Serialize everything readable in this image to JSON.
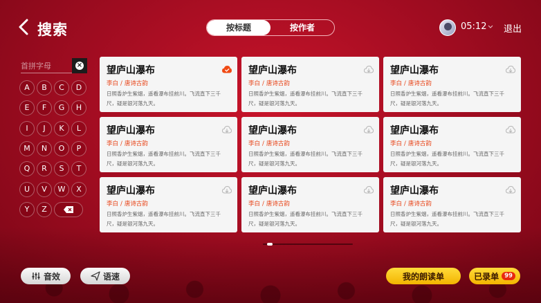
{
  "header": {
    "title": "搜索",
    "tabs": [
      {
        "label": "按标题",
        "active": true
      },
      {
        "label": "按作者",
        "active": false
      }
    ],
    "time": "05:12",
    "exit_label": "退出"
  },
  "search": {
    "placeholder": "首拼字母",
    "value": ""
  },
  "keyboard": {
    "keys": [
      "A",
      "B",
      "C",
      "D",
      "E",
      "F",
      "G",
      "H",
      "I",
      "J",
      "K",
      "L",
      "M",
      "N",
      "O",
      "P",
      "Q",
      "R",
      "S",
      "T",
      "U",
      "V",
      "W",
      "X",
      "Y",
      "Z"
    ],
    "delete_icon": "backspace-icon"
  },
  "cards": [
    {
      "title": "望庐山瀑布",
      "author": "李白",
      "category": "唐诗古韵",
      "text": "日照香炉生紫烟，遥看瀑布挂前川。飞流直下三千尺，疑是银河落九天。",
      "cloud_active": true
    },
    {
      "title": "望庐山瀑布",
      "author": "李白",
      "category": "唐诗古韵",
      "text": "日照香炉生紫烟，遥看瀑布挂前川。飞流直下三千尺，疑是银河落九天。",
      "cloud_active": false
    },
    {
      "title": "望庐山瀑布",
      "author": "李白",
      "category": "唐诗古韵",
      "text": "日照香炉生紫烟，遥看瀑布挂前川。飞流直下三千尺，疑是银河落九天。",
      "cloud_active": false
    },
    {
      "title": "望庐山瀑布",
      "author": "李白",
      "category": "唐诗古韵",
      "text": "日照香炉生紫烟，遥看瀑布挂前川。飞流直下三千尺，疑是银河落九天。",
      "cloud_active": false
    },
    {
      "title": "望庐山瀑布",
      "author": "李白",
      "category": "唐诗古韵",
      "text": "日照香炉生紫烟，遥看瀑布挂前川。飞流直下三千尺，疑是银河落九天。",
      "cloud_active": false
    },
    {
      "title": "望庐山瀑布",
      "author": "李白",
      "category": "唐诗古韵",
      "text": "日照香炉生紫烟，遥看瀑布挂前川。飞流直下三千尺，疑是银河落九天。",
      "cloud_active": false
    },
    {
      "title": "望庐山瀑布",
      "author": "李白",
      "category": "唐诗古韵",
      "text": "日照香炉生紫烟，遥看瀑布挂前川。飞流直下三千尺，疑是银河落九天。",
      "cloud_active": false
    },
    {
      "title": "望庐山瀑布",
      "author": "李白",
      "category": "唐诗古韵",
      "text": "日照香炉生紫烟，遥看瀑布挂前川。飞流直下三千尺，疑是银河落九天。",
      "cloud_active": false
    },
    {
      "title": "望庐山瀑布",
      "author": "李白",
      "category": "唐诗古韵",
      "text": "日照香炉生紫烟，遥看瀑布挂前川。飞流直下三千尺，疑是银河落九天。",
      "cloud_active": false
    }
  ],
  "separator": "/",
  "footer": {
    "effect_label": "音效",
    "speed_label": "语速",
    "my_reading_label": "我的朗读单",
    "recorded_label": "已录单",
    "recorded_count": "99"
  },
  "colors": {
    "accent_red": "#e84418",
    "cloud_active": "#f04a14",
    "cloud_inactive": "#b5b5b5",
    "button_yellow": "#f3b400"
  }
}
